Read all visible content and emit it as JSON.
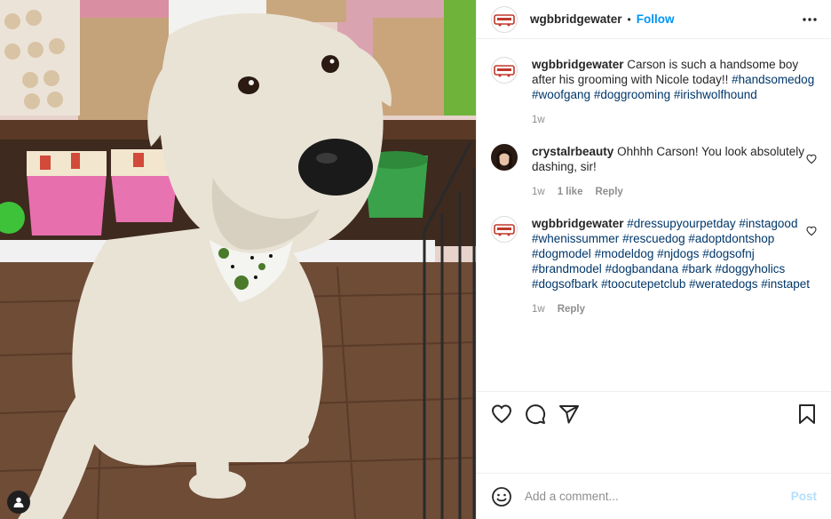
{
  "colors": {
    "accent": "#0095f6",
    "hashtag": "#00376b",
    "muted": "#8e8e8e",
    "post_disabled": "#b2dffc"
  },
  "photo": {
    "alt_subject": "white wolfhound dog sitting on wooden floor in pet store"
  },
  "header": {
    "username": "wgbbridgewater",
    "separator": "•",
    "follow_label": "Follow",
    "more_icon": "more-horizontal-icon"
  },
  "comments": [
    {
      "username": "wgbbridgewater",
      "text": "Carson is such a handsome boy after his grooming with Nicole today!!",
      "tags": [
        "#handsomedog",
        "#woofgang",
        "#doggrooming",
        "#irishwolfhound"
      ],
      "time": "1w"
    },
    {
      "username": "crystalrbeauty",
      "text": "Ohhhh Carson! You look absolutely dashing, sir!",
      "time": "1w",
      "likes": "1 like",
      "reply": "Reply"
    },
    {
      "username": "wgbbridgewater",
      "tags": [
        "#dressupyourpetday",
        "#instagood",
        "#whenissummer",
        "#rescuedog",
        "#adoptdontshop",
        "#dogmodel",
        "#modeldog",
        "#njdogs",
        "#dogsofnj",
        "#brandmodel",
        "#dogbandana",
        "#bark",
        "#doggyholics",
        "#dogsofbark",
        "#toocutepetclub",
        "#weratedogs",
        "#instapet"
      ],
      "time": "1w",
      "reply": "Reply"
    }
  ],
  "actions": {
    "like_icon": "heart-icon",
    "comment_icon": "comment-icon",
    "share_icon": "share-icon",
    "save_icon": "bookmark-icon"
  },
  "add_comment": {
    "placeholder": "Add a comment...",
    "post_label": "Post"
  }
}
